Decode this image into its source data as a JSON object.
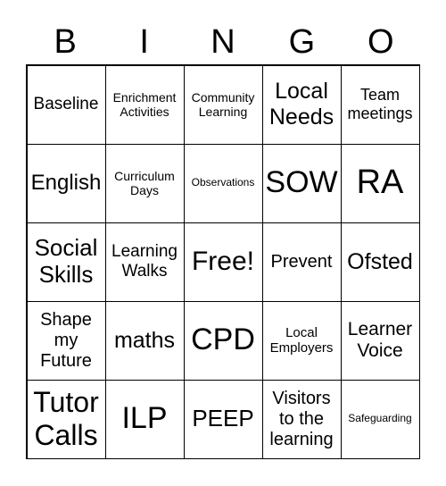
{
  "header": {
    "letters": [
      "B",
      "I",
      "N",
      "G",
      "O"
    ]
  },
  "cells": [
    "Baseline",
    "Enrichment Activities",
    "Community Learning",
    "Local Needs",
    "Team meetings",
    "English",
    "Curriculum Days",
    "Observations",
    "SOW",
    "RA",
    "Social Skills",
    "Learning Walks",
    "Free!",
    "Prevent",
    "Ofsted",
    "Shape my Future",
    "maths",
    "CPD",
    "Local Employers",
    "Learner Voice",
    "Tutor Calls",
    "ILP",
    "PEEP",
    "Visitors to the learning",
    "Safeguarding"
  ]
}
